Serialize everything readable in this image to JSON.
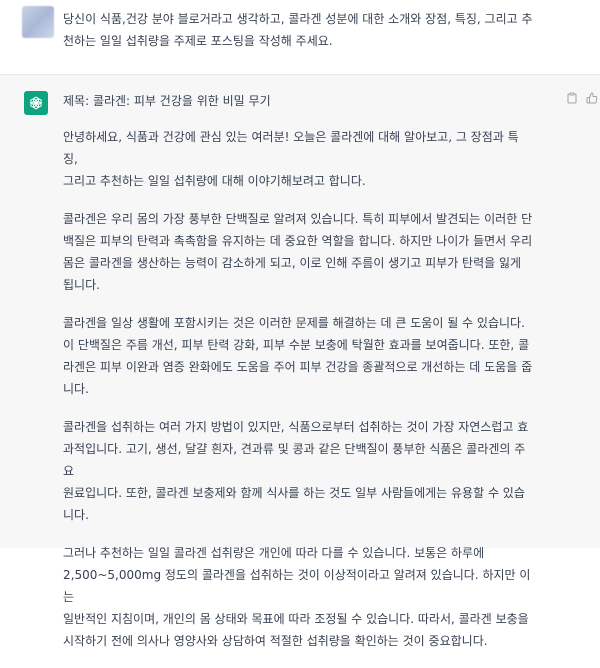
{
  "user": {
    "avatar_icon": "user-avatar-blurred",
    "message": "당신이 식품,건강 분야 블로거라고 생각하고, 콜라겐 성분에 대한 소개와 장점, 특징, 그리고 추\n천하는 일일 섭취량을 주제로 포스팅을 작성해 주세요."
  },
  "assistant": {
    "avatar_icon": "chatgpt-logo-icon",
    "avatar_color": "#10a37f",
    "title": "제목: 콜라겐: 피부 건강을 위한 비밀 무기",
    "paragraphs": [
      "안녕하세요, 식품과 건강에 관심 있는 여러분! 오늘은 콜라겐에 대해 알아보고, 그 장점과 특징,\n그리고 추천하는 일일 섭취량에 대해 이야기해보려고 합니다.",
      "콜라겐은 우리 몸의 가장 풍부한 단백질로 알려져 있습니다. 특히 피부에서 발견되는 이러한 단\n백질은 피부의 탄력과 촉촉함을 유지하는 데 중요한 역할을 합니다. 하지만 나이가 들면서 우리\n몸은 콜라겐을 생산하는 능력이 감소하게 되고, 이로 인해 주름이 생기고 피부가 탄력을 잃게\n됩니다.",
      "콜라겐을 일상 생활에 포함시키는 것은 이러한 문제를 해결하는 데 큰 도움이 될 수 있습니다.\n이 단백질은 주름 개선, 피부 탄력 강화, 피부 수분 보충에 탁월한 효과를 보여줍니다. 또한, 콜\n라겐은 피부 이완과 염증 완화에도 도움을 주어 피부 건강을 종괄적으로 개선하는 데 도움을 줍\n니다.",
      "콜라겐을 섭취하는 여러 가지 방법이 있지만, 식품으로부터 섭취하는 것이 가장 자연스럽고 효\n과적입니다. 고기, 생선, 달걀 흰자, 견과류 및 콩과 같은 단백질이 풍부한 식품은 콜라겐의 주요\n원료입니다. 또한, 콜라겐 보충제와 함께 식사를 하는 것도 일부 사람들에게는 유용할 수 있습\n니다.",
      "그러나 추천하는 일일 콜라겐 섭취량은 개인에 따라 다를 수 있습니다. 보통은 하루에\n2,500~5,000mg 정도의 콜라겐을 섭취하는 것이 이상적이라고 알려져 있습니다. 하지만 이는\n일반적인 지침이며, 개인의 몸 상태와 목표에 따라 조정될 수 있습니다. 따라서, 콜라겐 보충을\n시작하기 전에 의사나 영양사와 상담하여 적절한 섭취량을 확인하는 것이 중요합니다."
    ],
    "actions": [
      "copy-icon",
      "thumbs-up-icon",
      "thumbs-down-icon"
    ]
  }
}
